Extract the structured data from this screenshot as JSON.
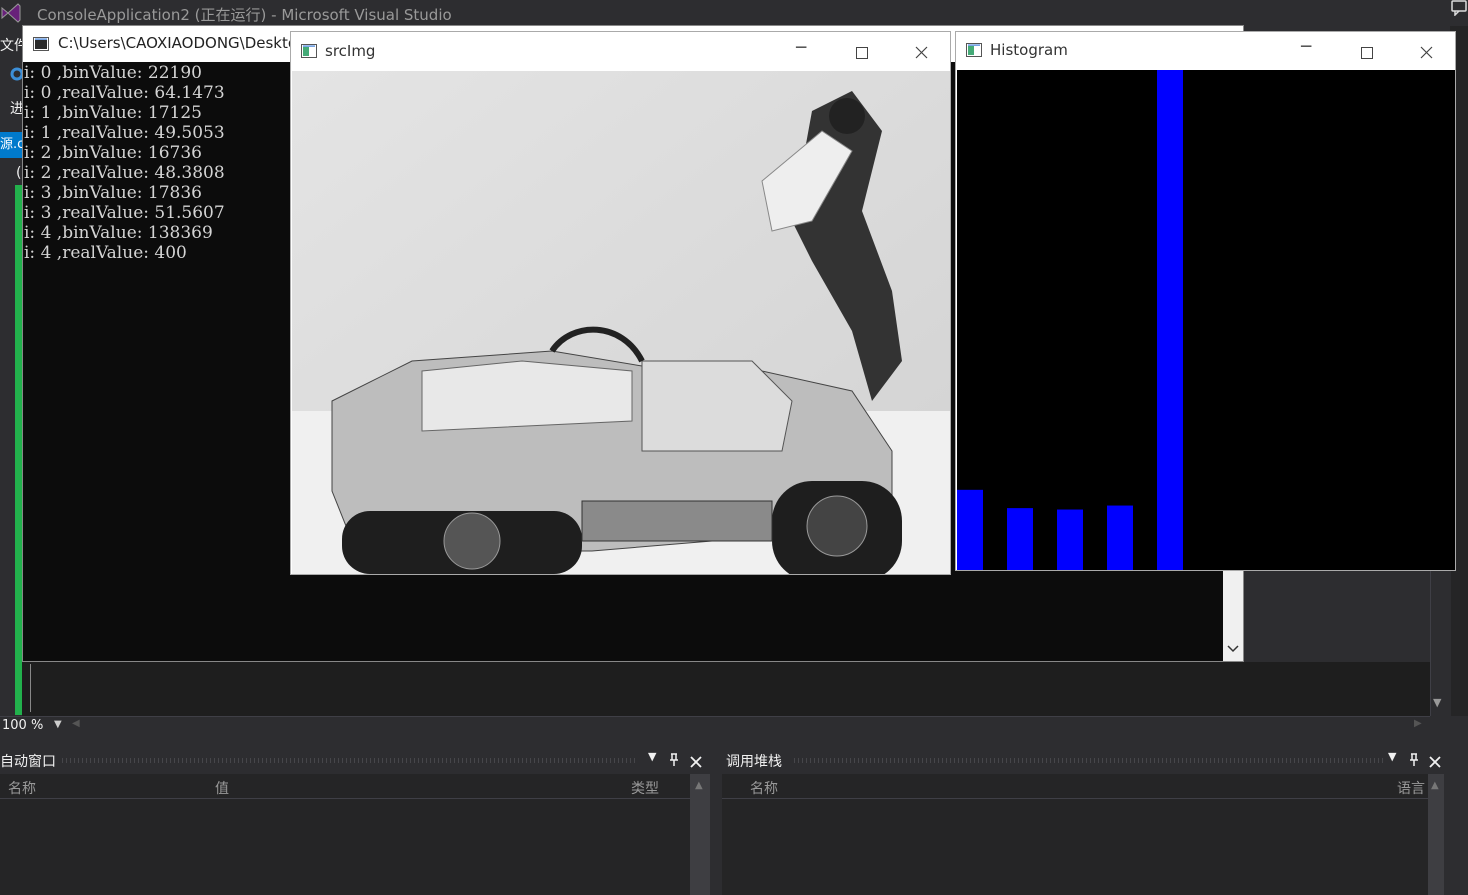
{
  "vs": {
    "title": "ConsoleApplication2 (正在运行) - Microsoft Visual Studio",
    "menu_file": "文件",
    "menu_progress": "进",
    "file_tab": "源.c",
    "paren": "(",
    "zoom": "100 %"
  },
  "console": {
    "title": "C:\\Users\\CAOXIAODONG\\Desktop",
    "lines": [
      "i: 0 ,binValue: 22190",
      "i: 0 ,realValue: 64.1473",
      "i: 1 ,binValue: 17125",
      "i: 1 ,realValue: 49.5053",
      "i: 2 ,binValue: 16736",
      "i: 2 ,realValue: 48.3808",
      "i: 3 ,binValue: 17836",
      "i: 3 ,realValue: 51.5607",
      "i: 4 ,binValue: 138369",
      "i: 4 ,realValue: 400"
    ]
  },
  "srcimg": {
    "title": "srcImg"
  },
  "histogram": {
    "title": "Histogram",
    "bar_color": "#0000ff",
    "bins": [
      64.1473,
      49.5053,
      48.3808,
      51.5607,
      400
    ],
    "max": 400
  },
  "auto_window": {
    "title": "自动窗口",
    "col_name": "名称",
    "col_value": "值",
    "col_type": "类型"
  },
  "call_stack": {
    "title": "调用堆栈",
    "col_name": "名称",
    "col_lang": "语言"
  },
  "colors": {
    "accent": "#007acc",
    "run_bar": "#22b14c"
  }
}
